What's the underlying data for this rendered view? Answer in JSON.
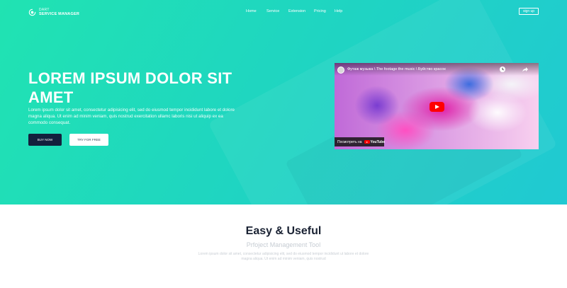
{
  "brand": {
    "small": "DART",
    "name": "SERVICE MANAGER"
  },
  "nav": {
    "items": [
      {
        "label": "Home"
      },
      {
        "label": "Service"
      },
      {
        "label": "Extension"
      },
      {
        "label": "Pricing"
      },
      {
        "label": "Help"
      }
    ],
    "signup": "sign up"
  },
  "hero": {
    "title": "LOREM IPSUM DOLOR SIT AMET",
    "description": "Lorem ipsum dolor sit amet, consectetur adipisicing elit, sed do eiusmod tempor incididunt labore et dolore magna aliqua. Ut enim ad minim veniam, quis nostrud exercitation ullamc laboris nisi ut aliquip ex ea commodo consequat.",
    "buy_label": "BUY NOW",
    "try_label": "TRY FOR FREE"
  },
  "video": {
    "title": "Футаж музыка \\ The footage the music \\ Буйство красок",
    "watch_on": "Посмотреть на",
    "platform": "YouTube"
  },
  "section": {
    "title": "Easy & Useful",
    "subtitle": "Prfoject Management Tool",
    "description": "Lorem ipsum dolor sit amet, consectetur adipisicing elit, sed do eiusmod tempor incididunt ut labore et dolore magna aliqua. Ut enim ad minim veniam, quis nostrud"
  },
  "colors": {
    "hero_gradient_start": "#20e3b2",
    "hero_gradient_end": "#20c9d2",
    "dark_button": "#13203d",
    "youtube_red": "#ff0000"
  }
}
